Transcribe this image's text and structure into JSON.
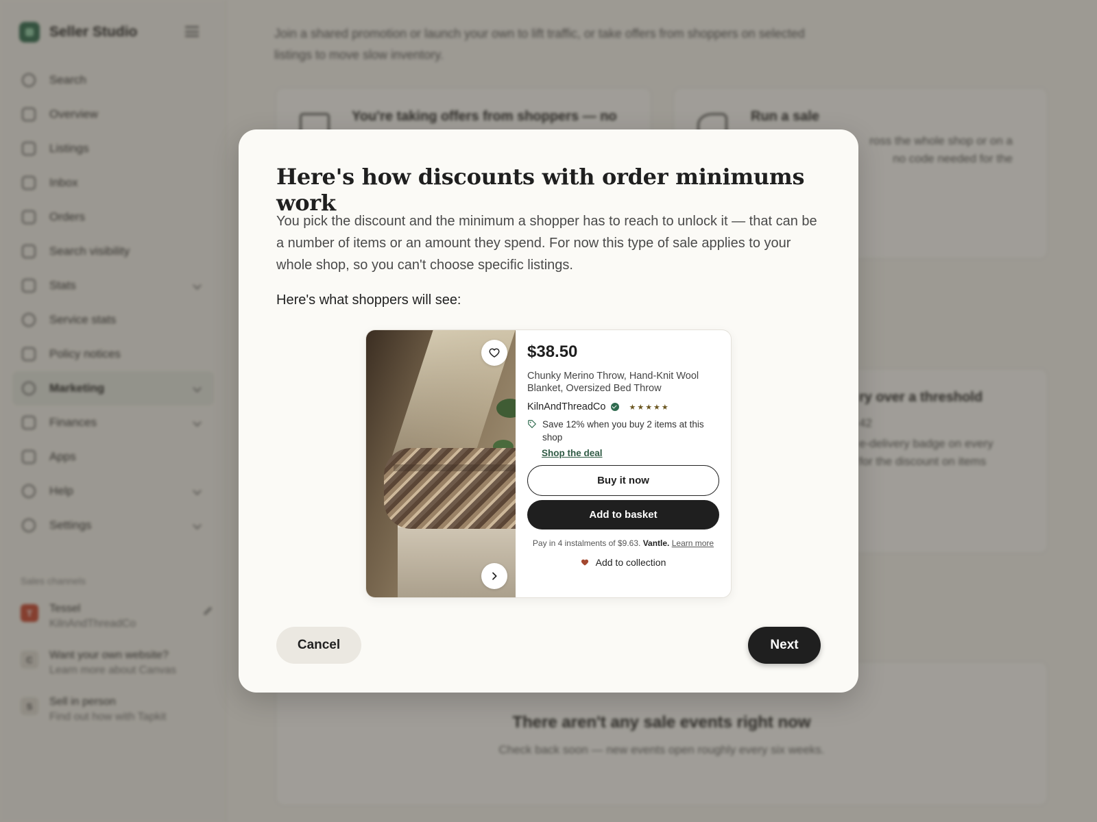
{
  "app": {
    "brand": "Seller Studio",
    "nav": [
      {
        "label": "Search"
      },
      {
        "label": "Overview"
      },
      {
        "label": "Listings"
      },
      {
        "label": "Inbox"
      },
      {
        "label": "Orders"
      },
      {
        "label": "Search visibility"
      },
      {
        "label": "Stats"
      },
      {
        "label": "Service stats"
      },
      {
        "label": "Policy notices"
      },
      {
        "label": "Marketing"
      },
      {
        "label": "Finances"
      },
      {
        "label": "Apps"
      },
      {
        "label": "Help"
      },
      {
        "label": "Settings"
      }
    ],
    "channels_title": "Sales channels",
    "channels": [
      {
        "badge": "T",
        "title": "Tessel",
        "sub": "KilnAndThreadCo"
      },
      {
        "badge": "C",
        "title": "Want your own website?",
        "sub": "Learn more about Canvas"
      },
      {
        "badge": "S",
        "title": "Sell in person",
        "sub": "Find out how with Tapkit"
      }
    ],
    "intro": "Join a shared promotion or launch your own to lift traffic, or take offers from shoppers on selected listings to move slow inventory.",
    "cards": {
      "offers_title": "You're taking offers from shoppers — no",
      "sale_title": "Run a sale",
      "sale_body_1": "ross the whole shop or on a",
      "sale_body_2": "no code needed for the",
      "threshold_title": "ry over a threshold",
      "threshold_sub": "42",
      "threshold_body_1": "e-delivery badge on every",
      "threshold_body_2": "for the discount on items"
    },
    "empty": {
      "title": "There aren't any sale events right now",
      "sub": "Check back soon — new events open roughly every six weeks."
    }
  },
  "modal": {
    "title": "Here's how discounts with order minimums work",
    "description": "You pick the discount and the minimum a shopper has to reach to unlock it — that can be a number of items or an amount they spend. For now this type of sale applies to your whole shop, so you can't choose specific listings.",
    "preview_label": "Here's what shoppers will see:",
    "preview": {
      "price": "$38.50",
      "title": "Chunky Merino Throw, Hand-Knit Wool Blanket, Oversized Bed Throw",
      "shop": "KilnAndThreadCo",
      "stars": "★★★★★",
      "rating": 5,
      "deal": "Save 12% when you buy 2 items at this shop",
      "deal_link": "Shop the deal",
      "buy_now": "Buy it now",
      "add_to_basket": "Add to basket",
      "instalments": "Pay in 4 instalments of $9.63.",
      "instalments_brand": "Vantle.",
      "learn_more": "Learn more",
      "add_to_collection": "Add to collection"
    },
    "cancel": "Cancel",
    "next": "Next"
  },
  "colors": {
    "accent_green": "#2f6b4f",
    "button_dark": "#1f1f1f",
    "heart": "#a3482f"
  }
}
